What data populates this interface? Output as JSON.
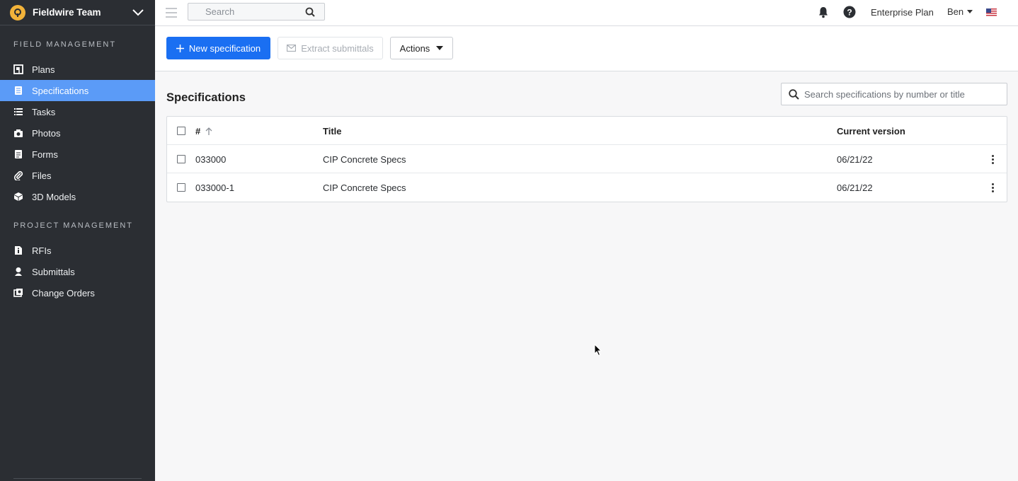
{
  "team": {
    "name": "Fieldwire Team"
  },
  "sidebar": {
    "field_section_title": "FIELD MANAGEMENT",
    "field_items": [
      {
        "label": "Plans",
        "icon": "plans-icon"
      },
      {
        "label": "Specifications",
        "icon": "specifications-icon",
        "active": true
      },
      {
        "label": "Tasks",
        "icon": "tasks-icon"
      },
      {
        "label": "Photos",
        "icon": "camera-icon"
      },
      {
        "label": "Forms",
        "icon": "forms-icon"
      },
      {
        "label": "Files",
        "icon": "paperclip-icon"
      },
      {
        "label": "3D Models",
        "icon": "cube-icon"
      }
    ],
    "project_section_title": "PROJECT MANAGEMENT",
    "project_items": [
      {
        "label": "RFIs",
        "icon": "rfi-icon"
      },
      {
        "label": "Submittals",
        "icon": "submittals-icon"
      },
      {
        "label": "Change Orders",
        "icon": "change-orders-icon"
      }
    ]
  },
  "topbar": {
    "search_placeholder": "Search",
    "plan_label": "Enterprise Plan",
    "user_name": "Ben"
  },
  "toolbar": {
    "new_spec_label": "New specification",
    "extract_label": "Extract submittals",
    "actions_label": "Actions"
  },
  "main": {
    "title": "Specifications",
    "search_placeholder": "Search specifications by number or title",
    "table": {
      "headers": {
        "number": "#",
        "title": "Title",
        "version": "Current version"
      },
      "rows": [
        {
          "number": "033000",
          "title": "CIP Concrete Specs",
          "version": "06/21/22"
        },
        {
          "number": "033000-1",
          "title": "CIP Concrete Specs",
          "version": "06/21/22"
        }
      ]
    }
  },
  "colors": {
    "sidebar_bg": "#2b2e33",
    "active_item": "#5b9bf7",
    "primary_button": "#1a6ff2",
    "logo": "#f2b33a"
  }
}
